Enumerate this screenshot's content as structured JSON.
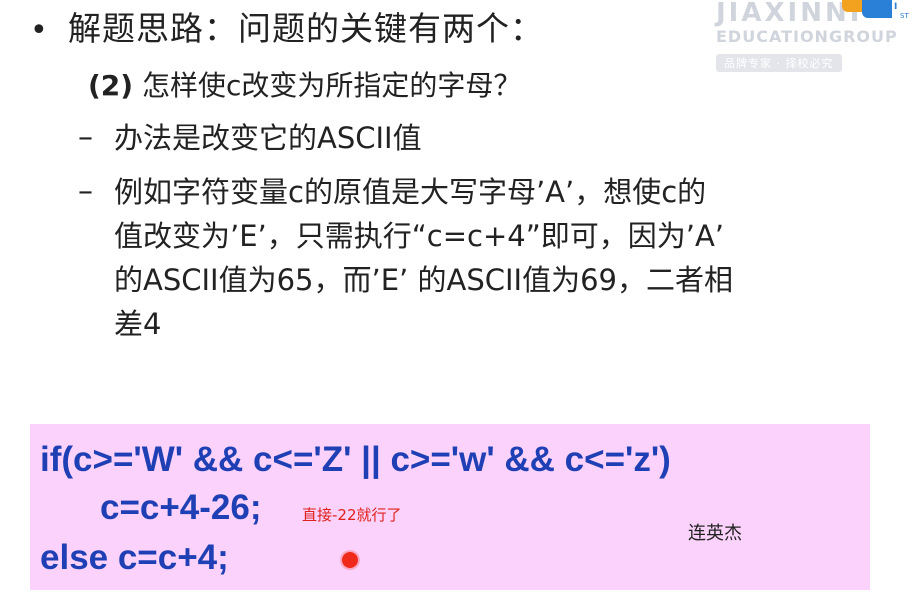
{
  "watermark": {
    "line1": "JIAXINNI",
    "line2": "EDUCATIONGROUP",
    "tagline": "品牌专家 · 择校必究",
    "corner_text": "I",
    "corner_sub": "ST"
  },
  "slide": {
    "title": "解题思路：问题的关键有两个：",
    "question_num": "(2)",
    "question_text": "怎样使c改变为所指定的字母？",
    "dash": "–",
    "point1": "办法是改变它的ASCII值",
    "point2_lines": [
      "例如字符变量c的原值是大写字母’A’，想使c的",
      "值改变为’E’，只需执行“c=c+4”即可，因为’A’",
      "的ASCII值为65，而’E’ 的ASCII值为69，二者相",
      "差4"
    ]
  },
  "code": {
    "line1": "if(c>='W' && c<='Z' || c>='w' && c<='z')",
    "line2": "c=c+4-26;",
    "line3": "else  c=c+4;",
    "annotation": "直接-22就行了",
    "author": "连英杰"
  },
  "colors": {
    "code_text": "#1f3fb4",
    "code_bg": "#fbd2fb",
    "annotation": "#e0201a",
    "cursor": "#f02a1a"
  }
}
